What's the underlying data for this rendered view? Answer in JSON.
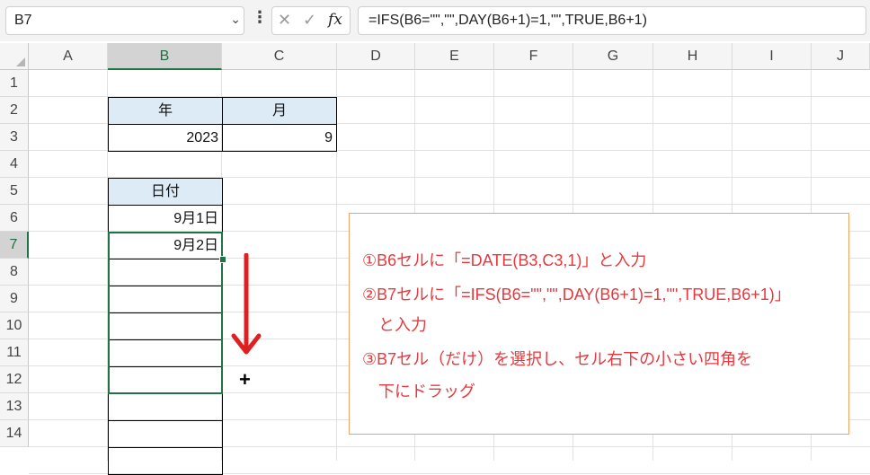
{
  "name_box": {
    "value": "B7",
    "dropdown_icon": "chevron-down-icon"
  },
  "formula_bar": {
    "more_icon": "vertical-dots-icon",
    "cancel_icon": "close-icon",
    "enter_icon": "check-icon",
    "fx_label": "fx",
    "formula": "=IFS(B6=\"\",\"\",DAY(B6+1)=1,\"\",TRUE,B6+1)"
  },
  "columns": [
    "A",
    "B",
    "C",
    "D",
    "E",
    "F",
    "G",
    "H",
    "I",
    "J"
  ],
  "selected_column": "B",
  "rows": [
    "1",
    "2",
    "3",
    "4",
    "5",
    "6",
    "7",
    "8",
    "9",
    "10",
    "11",
    "12",
    "13",
    "14"
  ],
  "selected_row": "7",
  "cells": {
    "B2": "年",
    "C2": "月",
    "B3": "2023",
    "C3": "9",
    "B5": "日付",
    "B6": "9月1日",
    "B7": "9月2日"
  },
  "annotation": {
    "lines": [
      "①B6セルに「=DATE(B3,C3,1)」と入力",
      "②B7セルに「=IFS(B6=\"\",\"\",DAY(B6+1)=1,\"\",TRUE,B6+1)」",
      "　と入力",
      "③B7セル（だけ）を選択し、セル右下の小さい四角を",
      "　下にドラッグ"
    ]
  },
  "colors": {
    "header_fill": "#ddebf7",
    "selection": "#217346",
    "annotation_text": "#e8383d",
    "annotation_border": "#f4a460",
    "arrow": "#e02020"
  }
}
